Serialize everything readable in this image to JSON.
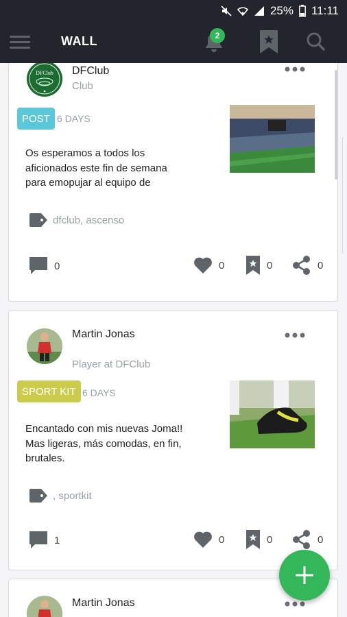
{
  "status_bar": {
    "battery": "25%",
    "time": "11:11"
  },
  "header": {
    "title": "WALL",
    "notification_count": "2"
  },
  "posts": [
    {
      "author": "DFClub",
      "subtitle": "Club",
      "avatar_text": "DFClub",
      "category": "POST",
      "category_color": "#5ac8d8",
      "age": "6 DAYS",
      "text": "Os esperamos a todos los aficionados este fin de semana para emopujar al equipo de",
      "tags": "dfclub,  ascenso",
      "comments": "0",
      "likes": "0",
      "saves": "0",
      "shares": "0"
    },
    {
      "author": "Martin Jonas",
      "subtitle": "Player at DFClub",
      "category": "SPORT KIT",
      "category_color": "#cbcc4e",
      "age": "6 DAYS",
      "text": "Encantado con mis nuevas Joma!! Mas ligeras, más comodas, en fin, brutales.",
      "tags": ", sportkit",
      "comments": "1",
      "likes": "0",
      "saves": "0",
      "shares": "0"
    },
    {
      "author": "Martin Jonas"
    }
  ],
  "colors": {
    "header_bg": "#23252d",
    "accent_green": "#34b75a",
    "icon_gray": "#5f6469"
  }
}
